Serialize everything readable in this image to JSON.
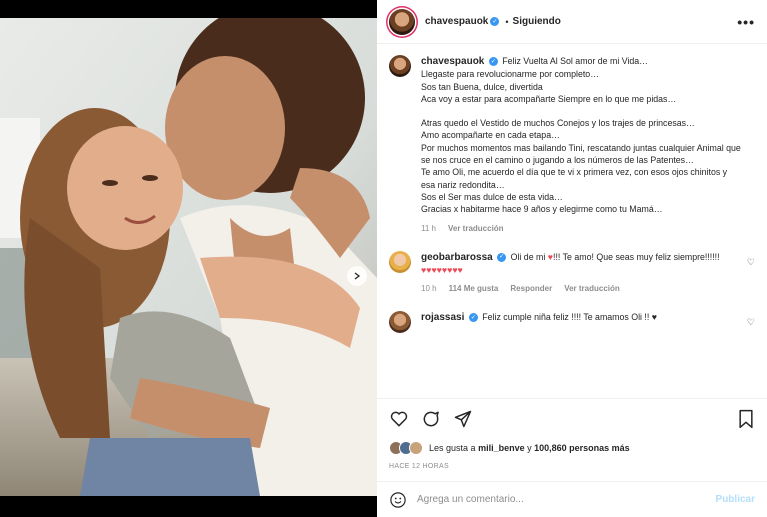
{
  "post": {
    "username": "chavespauok",
    "follow_state": "Siguiendo",
    "more_label": "•••"
  },
  "caption": {
    "username": "chavespauok",
    "lines": [
      "Feliz Vuelta Al Sol amor de mi Vida…",
      "Llegaste para revolucionarme por completo…",
      "Sos tan Buena, dulce, divertida",
      "Aca voy a estar para acompañarte Siempre en lo que me pidas…",
      "",
      "Atras quedo el Vestido de muchos Conejos y los trajes de princesas…",
      "Amo acompañarte en cada etapa…",
      "Por muchos momentos mas bailando Tini, rescatando juntas cualquier Animal que se nos cruce en el camino o jugando a los números de las Patentes…",
      "Te amo Oli, me acuerdo el día que te vi x primera vez, con esos ojos chinitos y esa nariz redondita…",
      "Sos el Ser mas dulce de esta vida…",
      "Gracias x habitarme hace 9 años y elegirme como tu Mamá…"
    ],
    "time": "11 h",
    "translate": "Ver traducción"
  },
  "comments": [
    {
      "username": "geobarbarossa",
      "text_before_heart": "Oli de mi",
      "text_after_heart": "!!! Te amo! Que seas muy feliz siempre!!!!!!",
      "hearts": "♥♥♥♥♥♥♥♥",
      "time": "10 h",
      "likes": "114 Me gusta",
      "reply": "Responder",
      "translate": "Ver traducción"
    },
    {
      "username": "rojassasi",
      "text": "Feliz cumple niña feliz !!!! Te amamos Oli !! ♥"
    }
  ],
  "likes": {
    "prefix": "Les gusta a",
    "user": "mili_benve",
    "conj": "y",
    "count": "100,860 personas más"
  },
  "posted_ago": "HACE 12 HORAS",
  "composer": {
    "placeholder": "Agrega un comentario...",
    "publish": "Publicar"
  },
  "colors": {
    "verified": "#3897f0",
    "heart_red": "#ed4956",
    "publish_disabled": "#b2dffc"
  }
}
